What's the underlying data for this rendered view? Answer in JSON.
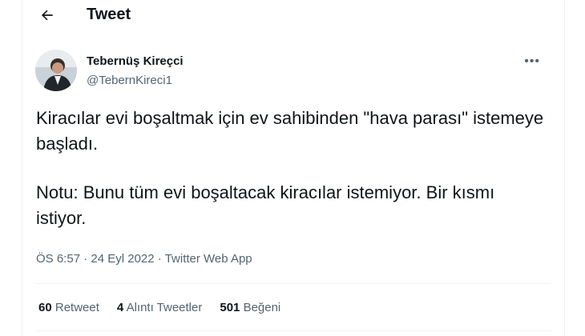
{
  "header": {
    "title": "Tweet",
    "back_icon": "arrow-left-icon"
  },
  "author": {
    "display_name": "Tebernüş Kireçci",
    "handle": "@TebernKireci1",
    "more_icon": "more-horizontal-icon"
  },
  "tweet": {
    "paragraphs": [
      "Kiracılar evi boşaltmak için ev sahibinden \"hava parası\" istemeye başladı.",
      "Notu: Bunu tüm evi boşaltacak kiracılar istemiyor. Bir kısmı istiyor."
    ],
    "time": "ÖS 6:57",
    "separator": "·",
    "date": "24 Eyl 2022",
    "source": "Twitter Web App"
  },
  "stats": [
    {
      "count": "60",
      "label": "Retweet"
    },
    {
      "count": "4",
      "label": "Alıntı Tweetler"
    },
    {
      "count": "501",
      "label": "Beğeni"
    }
  ],
  "colors": {
    "text": "#0f1419",
    "secondary": "#536471",
    "border": "#eff3f4"
  }
}
